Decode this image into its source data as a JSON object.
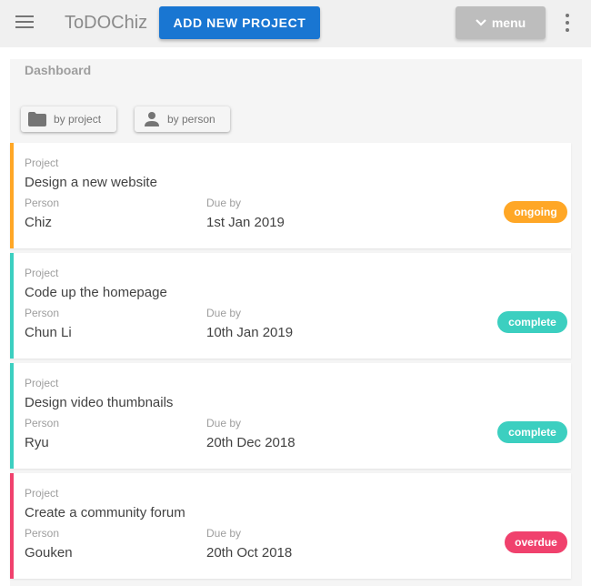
{
  "header": {
    "app_title": "ToDOChiz",
    "add_project_label": "ADD NEW PROJECT",
    "menu_label": "menu",
    "menu_icon": "chevron-down-icon",
    "nav_icon": "hamburger-menu-icon",
    "more_icon": "more-vertical-icon",
    "accent_color": "#1976d2"
  },
  "dashboard": {
    "title": "Dashboard",
    "sort_by_project_label": "by project",
    "sort_by_person_label": "by person",
    "sort_by_project_icon": "folder-icon",
    "sort_by_person_icon": "person-icon"
  },
  "projects": [
    {
      "project_label": "Project",
      "title": "Design a new website",
      "person_label": "Person",
      "person": "Chiz",
      "due_label": "Due by",
      "due": "1st Jan 2019",
      "status": "ongoing",
      "status_color": "#ffa726"
    },
    {
      "project_label": "Project",
      "title": "Code up the homepage",
      "person_label": "Person",
      "person": "Chun Li",
      "due_label": "Due by",
      "due": "10th Jan 2019",
      "status": "complete",
      "status_color": "#3ccfc0"
    },
    {
      "project_label": "Project",
      "title": "Design video thumbnails",
      "person_label": "Person",
      "person": "Ryu",
      "due_label": "Due by",
      "due": "20th Dec 2018",
      "status": "complete",
      "status_color": "#3ccfc0"
    },
    {
      "project_label": "Project",
      "title": "Create a community forum",
      "person_label": "Person",
      "person": "Gouken",
      "due_label": "Due by",
      "due": "20th Oct 2018",
      "status": "overdue",
      "status_color": "#f0416d"
    }
  ]
}
